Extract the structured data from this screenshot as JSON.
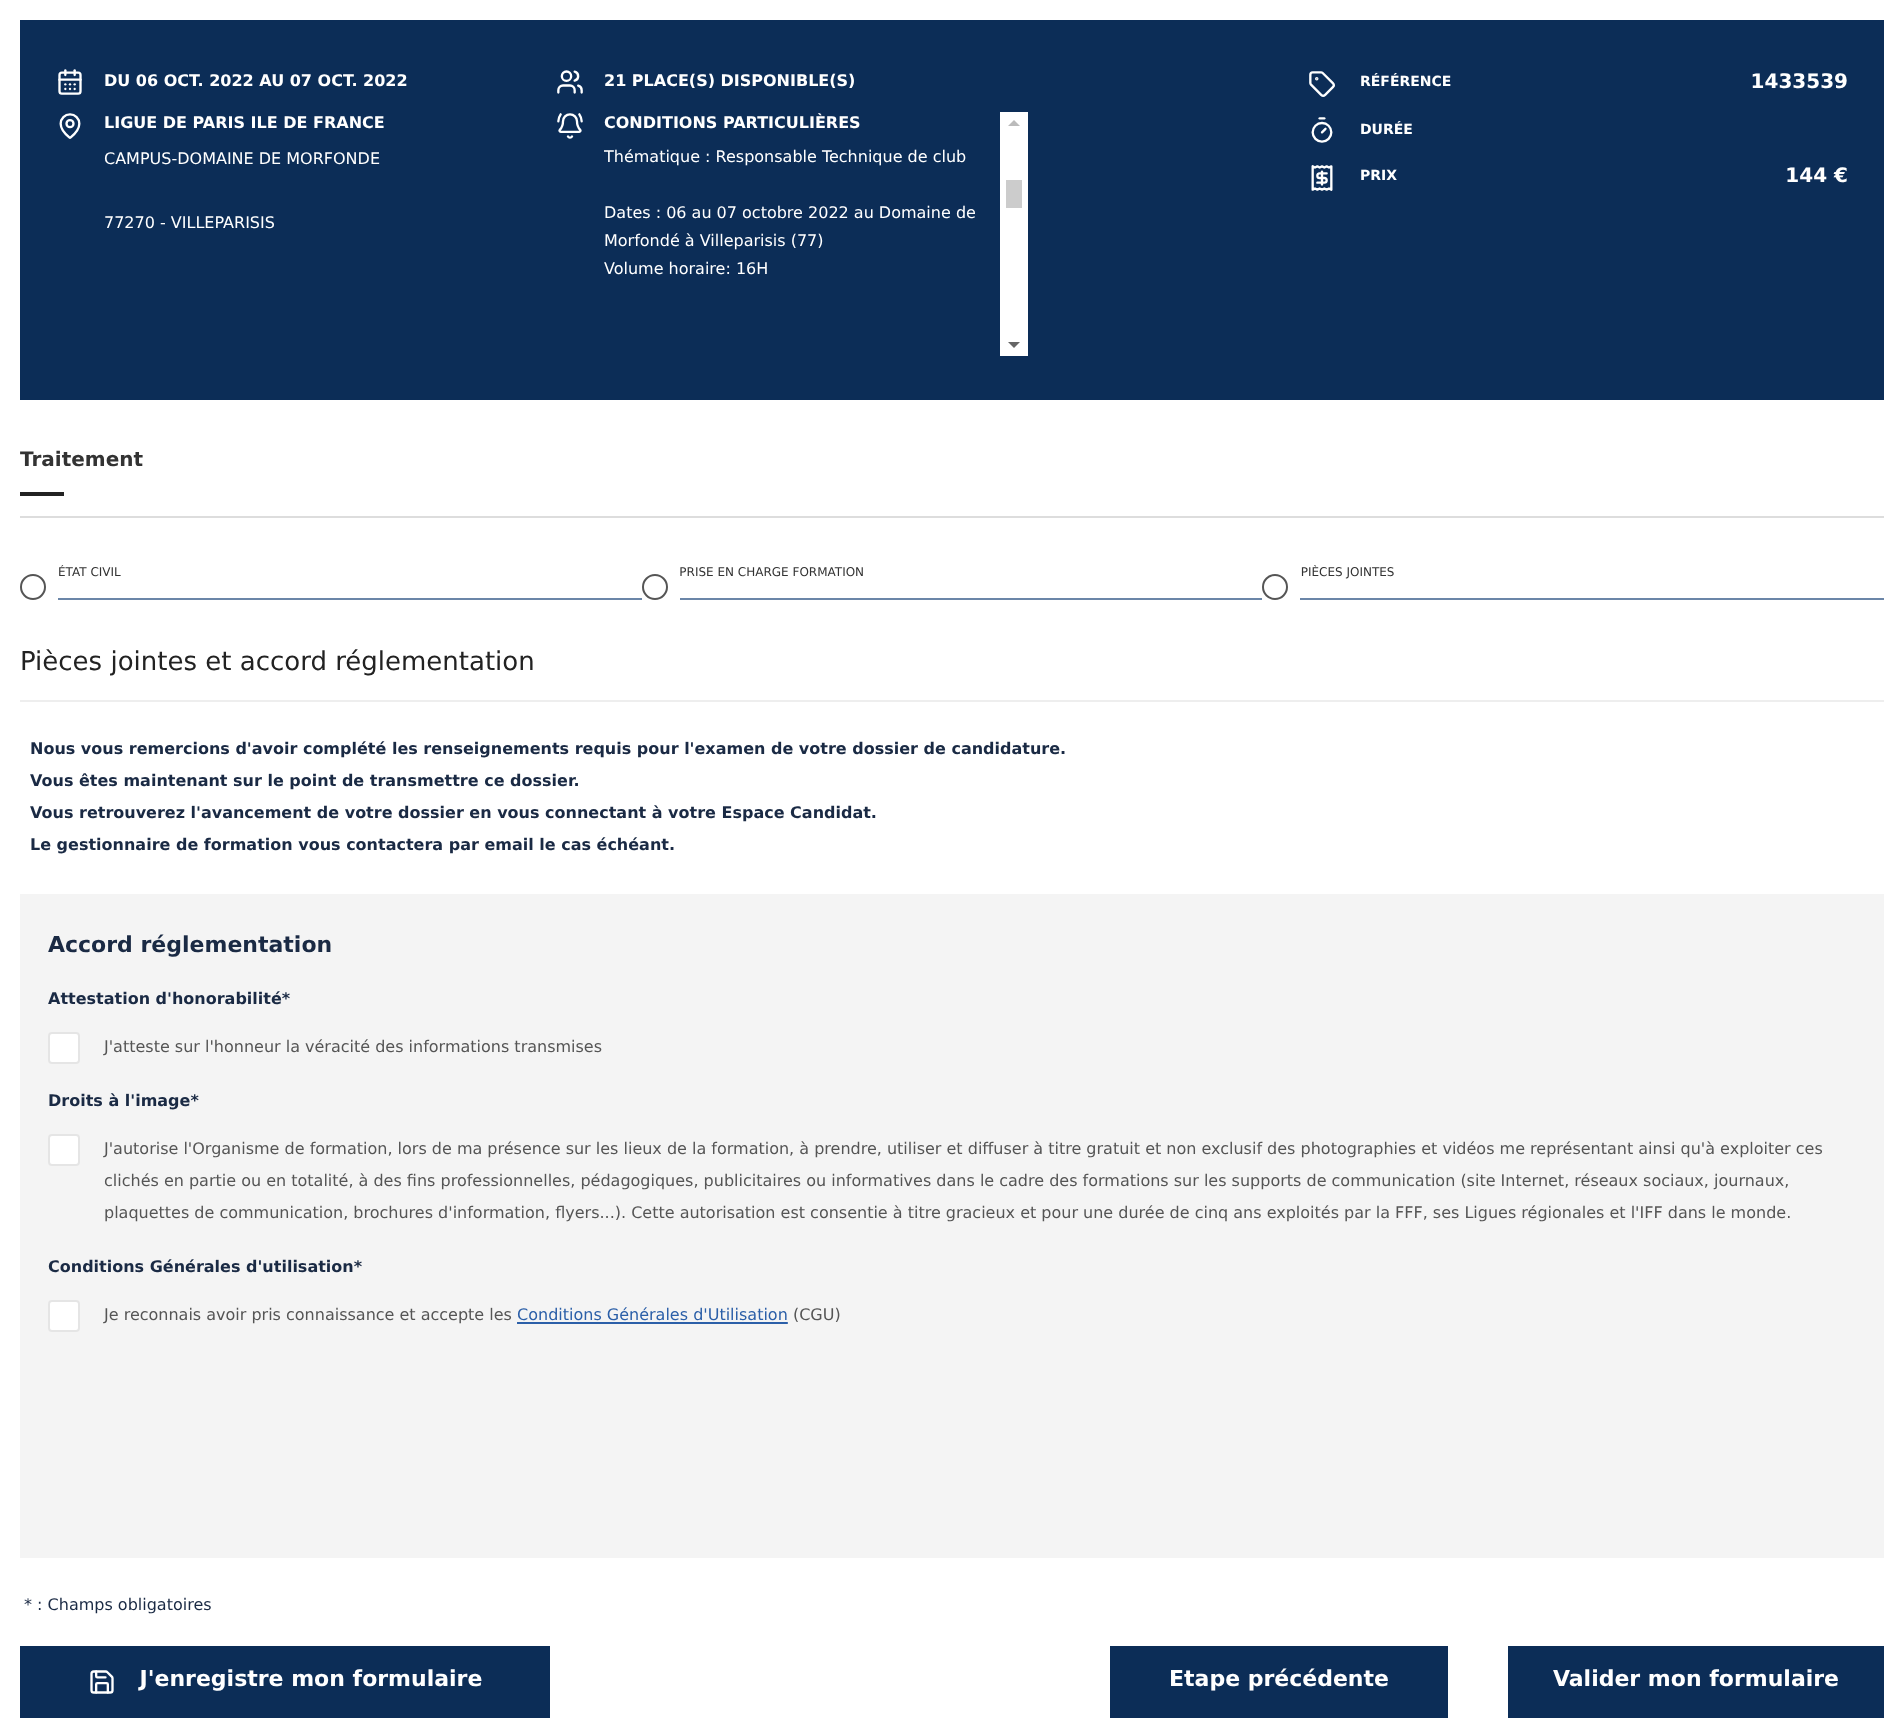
{
  "summary": {
    "dates": "DU 06 OCT. 2022 AU 07 OCT. 2022",
    "places": "21 PLACE(S) DISPONIBLE(S)",
    "location": {
      "title": "LIGUE DE PARIS ILE DE FRANCE",
      "line_1": "CAMPUS-DOMAINE DE MORFONDE",
      "line_2": "77270 - VILLEPARISIS"
    },
    "conditions": {
      "title": "CONDITIONS PARTICULIÈRES",
      "paragraphs": [
        "Thématique : Responsable Technique de club",
        "Dates : 06 au 07 octobre 2022 au Domaine de Morfondé à Villeparisis (77)\nVolume horaire: 16H"
      ]
    },
    "facts": [
      {
        "kind": "tag",
        "label": "RÉFÉRENCE",
        "value": "1433539"
      },
      {
        "kind": "timer",
        "label": "DURÉE"
      },
      {
        "kind": "price",
        "label": "PRIX",
        "value": "144 €"
      }
    ]
  },
  "section_tab": "Traitement",
  "steps": [
    {
      "label": "ÉTAT CIVIL",
      "checked": false
    },
    {
      "label": "PRISE EN CHARGE FORMATION",
      "checked": false
    },
    {
      "label": "PIÈCES JOINTES",
      "checked": false
    }
  ],
  "heading": "Pièces jointes et accord réglementation",
  "intro": [
    "Nous vous remercions d'avoir complété les renseignements requis pour l'examen de votre dossier de candidature.",
    "Vous êtes maintenant sur le point de transmettre ce dossier.",
    "Vous retrouverez l'avancement de votre dossier en vous connectant à votre Espace Candidat.",
    "Le gestionnaire de formation vous contactera par email le cas échéant."
  ],
  "panel": {
    "title": "Accord réglementation",
    "fields": [
      {
        "label": "Attestation d'honorabilité*",
        "text": "J'atteste sur l'honneur la véracité des informations transmises",
        "checked": false
      },
      {
        "label": "Droits à l'image*",
        "text": "J'autorise l'Organisme de formation, lors de ma présence sur les lieux de la formation, à prendre, utiliser et diffuser à titre gratuit et non exclusif des photographies et vidéos me représentant ainsi qu'à exploiter ces clichés en partie ou en totalité, à des fins professionnelles, pédagogiques, publicitaires ou informatives dans le cadre des formations sur les supports de communication (site Internet, réseaux sociaux, journaux, plaquettes de communication, brochures d'information, flyers...). Cette autorisation est consentie à titre gracieux et pour une durée de cinq ans exploités par la FFF, ses Ligues régionales et l'IFF dans le monde.",
        "checked": false
      },
      {
        "label": "Conditions Générales d'utilisation*",
        "text": "Je reconnais avoir pris connaissance et accepte les",
        "link": "Conditions Générales d'Utilisation",
        "after": "(CGU)",
        "checked": false
      }
    ]
  },
  "required_note": "* : Champs obligatoires",
  "buttons": {
    "save": "J'enregistre mon formulaire",
    "previous": "Etape précédente",
    "submit": "Valider mon formulaire"
  }
}
